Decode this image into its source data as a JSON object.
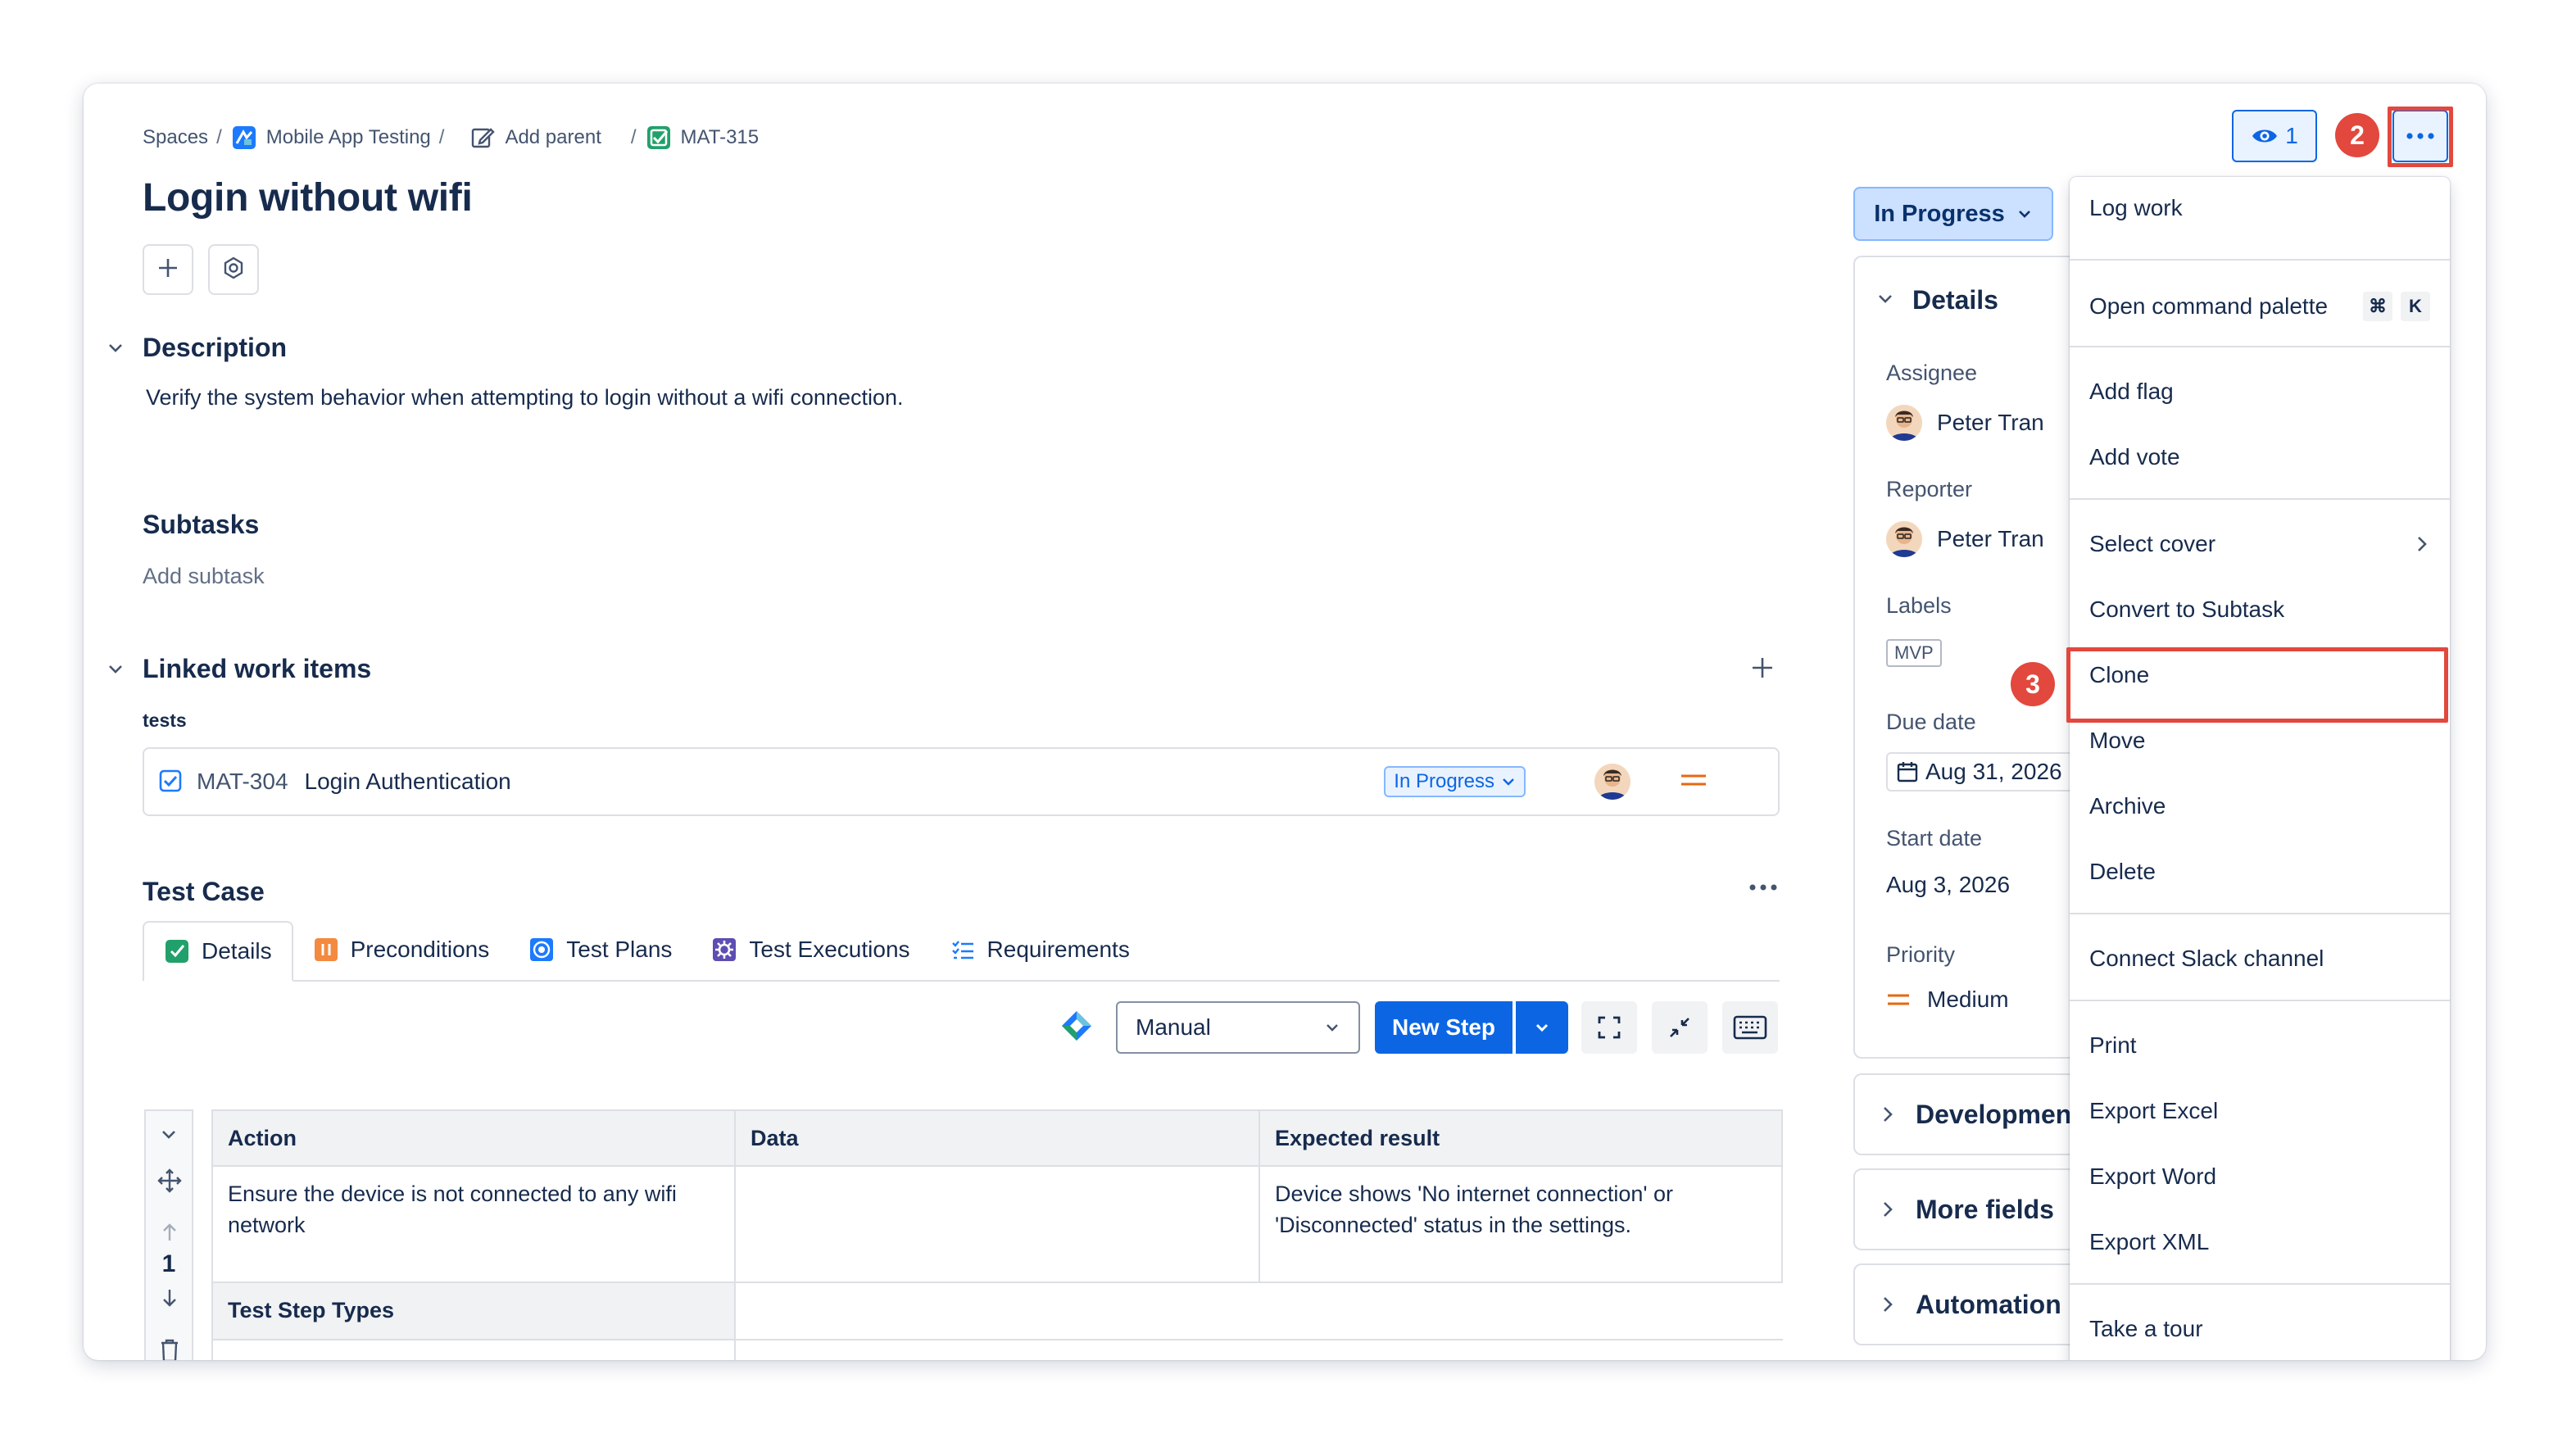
{
  "breadcrumb": {
    "spaces": "Spaces",
    "project": "Mobile App Testing",
    "add_parent": "Add parent",
    "issue_key": "MAT-315",
    "separator": "/"
  },
  "issue": {
    "title": "Login without wifi"
  },
  "description": {
    "heading": "Description",
    "text": "Verify the system behavior when attempting to login without a wifi connection."
  },
  "subtasks": {
    "heading": "Subtasks",
    "add_label": "Add subtask"
  },
  "linked": {
    "heading": "Linked work items",
    "relation": "tests",
    "item_key": "MAT-304",
    "item_title": "Login Authentication",
    "item_status": "In Progress"
  },
  "test_case": {
    "heading": "Test Case",
    "tabs": [
      "Details",
      "Preconditions",
      "Test Plans",
      "Test Executions",
      "Requirements"
    ],
    "type_select": "Manual",
    "new_step": "New Step",
    "table": {
      "headers": [
        "Action",
        "Data",
        "Expected result"
      ],
      "row_number": "1",
      "action": "Ensure the device is not connected to any wifi network",
      "data": "",
      "expected": "Device shows 'No internet connection' or 'Disconnected' status in the settings.",
      "step_types_label": "Test Step Types"
    }
  },
  "right_panel": {
    "status": "In Progress",
    "details_heading": "Details",
    "assignee_label": "Assignee",
    "assignee": "Peter Tran",
    "reporter_label": "Reporter",
    "reporter": "Peter Tran",
    "labels_label": "Labels",
    "label_tag": "MVP",
    "due_label": "Due date",
    "due": "Aug 31, 2026",
    "start_label": "Start date",
    "start": "Aug 3, 2026",
    "priority_label": "Priority",
    "priority": "Medium",
    "development": "Development",
    "more_fields": "More fields",
    "automation": "Automation"
  },
  "watch_count": "1",
  "annotations": {
    "step2": "2",
    "step3": "3",
    "highlight_color": "#e2483d"
  },
  "menu": {
    "log_work": "Log work",
    "command_palette": "Open command palette",
    "kbd_cmd": "⌘",
    "kbd_k": "K",
    "add_flag": "Add flag",
    "add_vote": "Add vote",
    "select_cover": "Select cover",
    "convert": "Convert to Subtask",
    "clone": "Clone",
    "move": "Move",
    "archive": "Archive",
    "delete": "Delete",
    "slack": "Connect Slack channel",
    "print": "Print",
    "export_excel": "Export Excel",
    "export_word": "Export Word",
    "export_xml": "Export XML",
    "tour": "Take a tour"
  },
  "colors": {
    "primary": "#0c66e4",
    "status_bg": "#cce0ff",
    "priority": "#e56910"
  }
}
